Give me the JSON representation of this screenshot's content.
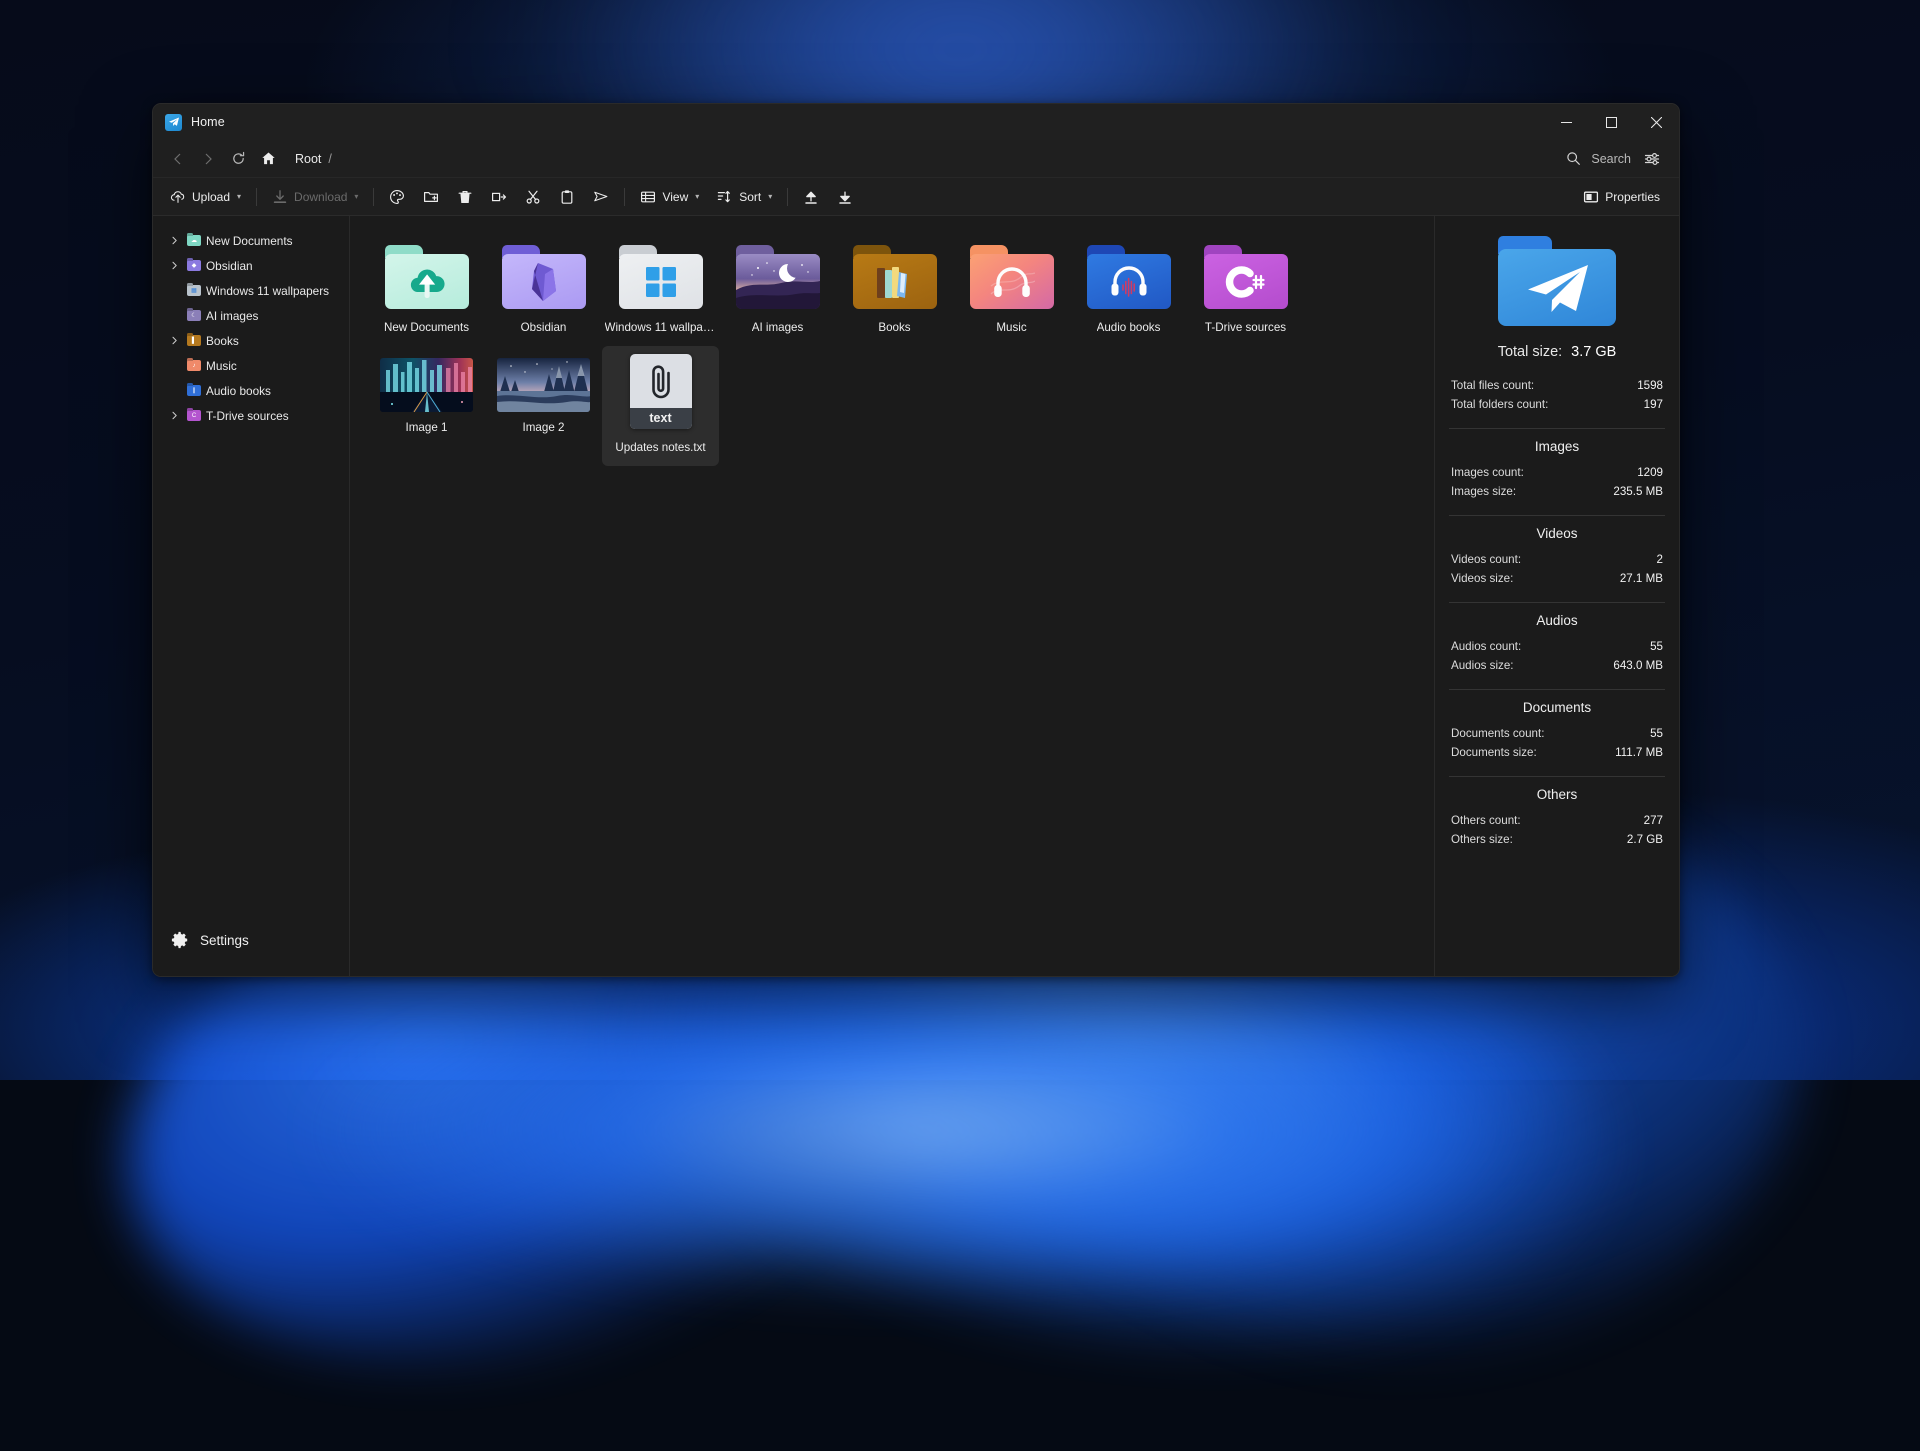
{
  "window": {
    "title": "Home",
    "app_icon": "telegram-paperplane-icon",
    "minimize": "minimize-icon",
    "maximize": "maximize-icon",
    "close": "close-icon"
  },
  "address_bar": {
    "back": "chevron-left-icon",
    "forward": "chevron-right-icon",
    "refresh": "refresh-icon",
    "home": "home-icon",
    "crumb_root": "Root",
    "crumb_separator": "/",
    "search_placeholder": "Search",
    "search_icon": "search-icon",
    "filter_icon": "filter-sliders-icon"
  },
  "toolbar": {
    "upload": "Upload",
    "download": "Download",
    "view": "View",
    "sort": "Sort",
    "properties": "Properties",
    "caret": "▾",
    "icon_names": [
      "cloud-upload-icon",
      "download-icon",
      "palette-icon",
      "new-folder-icon",
      "delete-icon",
      "rename-icon",
      "cut-icon",
      "paste-icon",
      "send-icon",
      "view-list-icon",
      "sort-icon",
      "upload-arrow-icon",
      "download-arrow-icon",
      "properties-panel-icon"
    ]
  },
  "sidebar": {
    "items": [
      {
        "label": "New Documents",
        "expandable": true,
        "color": "#7fd8c4"
      },
      {
        "label": "Obsidian",
        "expandable": true,
        "color": "#8b7ae0"
      },
      {
        "label": "Windows 11 wallpapers",
        "expandable": false,
        "color": "#b9c3cc"
      },
      {
        "label": "AI images",
        "expandable": false,
        "color": "#8b7fb8"
      },
      {
        "label": "Books",
        "expandable": true,
        "color": "#b5791f"
      },
      {
        "label": "Music",
        "expandable": false,
        "color": "#f08a6a"
      },
      {
        "label": "Audio books",
        "expandable": false,
        "color": "#2f6fd8"
      },
      {
        "label": "T-Drive sources",
        "expandable": true,
        "color": "#b455cf"
      }
    ],
    "settings": "Settings",
    "settings_icon": "gear-icon",
    "chevron_icon": "chevron-right-icon"
  },
  "files": [
    {
      "name": "New Documents",
      "type": "folder",
      "art": "cloud-upload",
      "tab": "#8fdcc8",
      "face": "#c7f0e4"
    },
    {
      "name": "Obsidian",
      "type": "folder",
      "art": "obsidian-gem",
      "tab": "#6f5ed6",
      "face": "#b6a8f6"
    },
    {
      "name": "Windows 11 wallpapers",
      "type": "folder",
      "art": "windows-logo",
      "tab": "#c9cdd2",
      "face": "#e8eaed"
    },
    {
      "name": "AI images",
      "type": "folder",
      "art": "night-moon",
      "tab": "#6a5a9a",
      "face": "#2a2150"
    },
    {
      "name": "Books",
      "type": "folder",
      "art": "books",
      "tab": "#8a5d0d",
      "face": "#ae7215"
    },
    {
      "name": "Music",
      "type": "folder",
      "art": "headphones",
      "tab": "#f0835f",
      "face": "#f1968c"
    },
    {
      "name": "Audio books",
      "type": "folder",
      "art": "audio-waves",
      "tab": "#1f49b8",
      "face": "#2b6fd8"
    },
    {
      "name": "T-Drive sources",
      "type": "folder",
      "art": "csharp",
      "tab": "#a844c7",
      "face": "#c155dc"
    },
    {
      "name": "Image 1",
      "type": "image",
      "art": "cyber-city"
    },
    {
      "name": "Image 2",
      "type": "image",
      "art": "winter-forest"
    },
    {
      "name": "Updates notes.txt",
      "type": "file",
      "art": "paperclip",
      "ext_label": "text",
      "selected": true
    }
  ],
  "properties": {
    "hero_icon": "telegram-folder-icon",
    "total_size_label": "Total size:",
    "total_size_value": "3.7 GB",
    "top_rows": [
      {
        "key": "Total files count:",
        "value": "1598"
      },
      {
        "key": "Total folders count:",
        "value": "197"
      }
    ],
    "sections": [
      {
        "title": "Images",
        "rows": [
          {
            "key": "Images count:",
            "value": "1209"
          },
          {
            "key": "Images size:",
            "value": "235.5 MB"
          }
        ]
      },
      {
        "title": "Videos",
        "rows": [
          {
            "key": "Videos count:",
            "value": "2"
          },
          {
            "key": "Videos size:",
            "value": "27.1 MB"
          }
        ]
      },
      {
        "title": "Audios",
        "rows": [
          {
            "key": "Audios count:",
            "value": "55"
          },
          {
            "key": "Audios size:",
            "value": "643.0 MB"
          }
        ]
      },
      {
        "title": "Documents",
        "rows": [
          {
            "key": "Documents count:",
            "value": "55"
          },
          {
            "key": "Documents size:",
            "value": "111.7 MB"
          }
        ]
      },
      {
        "title": "Others",
        "rows": [
          {
            "key": "Others count:",
            "value": "277"
          },
          {
            "key": "Others size:",
            "value": "2.7 GB"
          }
        ]
      }
    ]
  },
  "colors": {
    "window_bg": "#1b1b1b",
    "titlebar_bg": "#202020",
    "accent_blue": "#2f95dc",
    "text_primary": "#ececec"
  }
}
